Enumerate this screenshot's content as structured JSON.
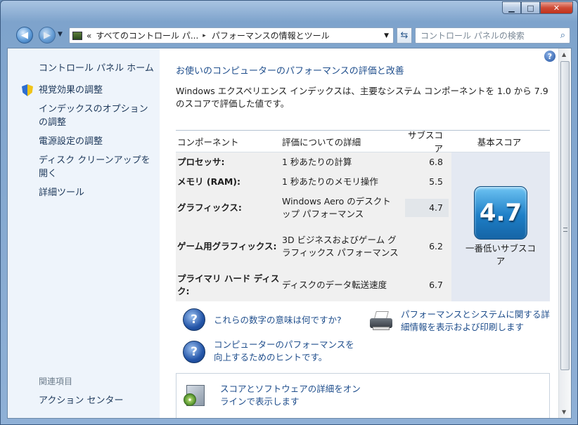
{
  "window": {
    "caption": {
      "minimize": "▁",
      "maximize": "□",
      "close": "✕"
    }
  },
  "address_bar": {
    "prefix": "«",
    "segments": [
      "すべてのコントロール パ...",
      "パフォーマンスの情報とツール"
    ],
    "separator": "▸",
    "search_placeholder": "コントロール パネルの検索"
  },
  "sidebar": {
    "home": "コントロール パネル ホーム",
    "items": [
      {
        "label": "視覚効果の調整",
        "icon": "shield-icon"
      },
      {
        "label": "インデックスのオプションの調整"
      },
      {
        "label": "電源設定の調整"
      },
      {
        "label": "ディスク クリーンアップを開く"
      },
      {
        "label": "詳細ツール"
      }
    ],
    "related_heading": "関連項目",
    "related_link": "アクション センター"
  },
  "main": {
    "heading": "お使いのコンピューターのパフォーマンスの評価と改善",
    "description": "Windows エクスペリエンス インデックスは、主要なシステム コンポーネントを 1.0 から 7.9 のスコアで評価した値です。",
    "table": {
      "headers": [
        "コンポーネント",
        "評価についての詳細",
        "サブスコア",
        "基本スコア"
      ],
      "rows": [
        {
          "component": "プロセッサ:",
          "detail": "1 秒あたりの計算",
          "subscore": "6.8"
        },
        {
          "component": "メモリ (RAM):",
          "detail": "1 秒あたりのメモリ操作",
          "subscore": "5.5"
        },
        {
          "component": "グラフィックス:",
          "detail": "Windows Aero のデスクトップ パフォーマンス",
          "subscore": "4.7"
        },
        {
          "component": "ゲーム用グラフィックス:",
          "detail": "3D ビジネスおよびゲーム グラフィックス パフォーマンス",
          "subscore": "6.2"
        },
        {
          "component": "プライマリ ハード ディスク:",
          "detail": "ディスクのデータ転送速度",
          "subscore": "6.7"
        }
      ],
      "base_score": "4.7",
      "base_score_label": "一番低いサブスコア"
    },
    "links": {
      "what_numbers_mean": "これらの数字の意味は何ですか?",
      "print_details": "パフォーマンスとシステムに関する詳細情報を表示および印刷します",
      "improve_tips": "コンピューターのパフォーマンスを向上するためのヒントです。",
      "view_online": "スコアとソフトウェアの詳細をオンラインで表示します"
    }
  },
  "colors": {
    "link": "#1f4e8c",
    "sidebar_bg": "#eef4fb",
    "badge": "#1e7fc7"
  }
}
